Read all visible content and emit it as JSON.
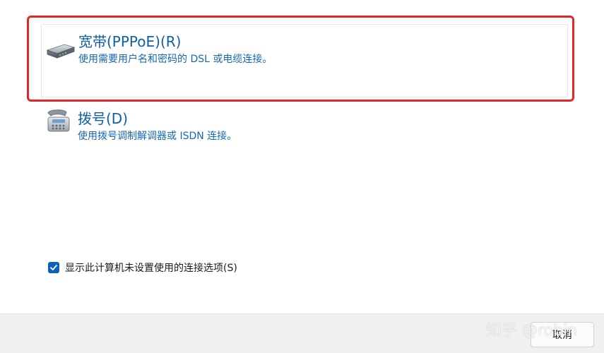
{
  "options": [
    {
      "title": "宽带(PPPoE)(R)",
      "description": "使用需要用户名和密码的 DSL 或电缆连接。",
      "icon": "broadband-modem-icon",
      "selected": true
    },
    {
      "title": "拨号(D)",
      "description": "使用拨号调制解调器或 ISDN 连接。",
      "icon": "dialup-phone-icon",
      "selected": false
    }
  ],
  "show_unconfigured": {
    "label": "显示此计算机未设置使用的连接选项(S)",
    "checked": true
  },
  "footer": {
    "cancel_label": "取消"
  },
  "watermark": "知乎 @robin",
  "colors": {
    "link_blue": "#0f5fa8",
    "highlight_red": "#e8232a",
    "checkbox_blue": "#0a63b8"
  }
}
